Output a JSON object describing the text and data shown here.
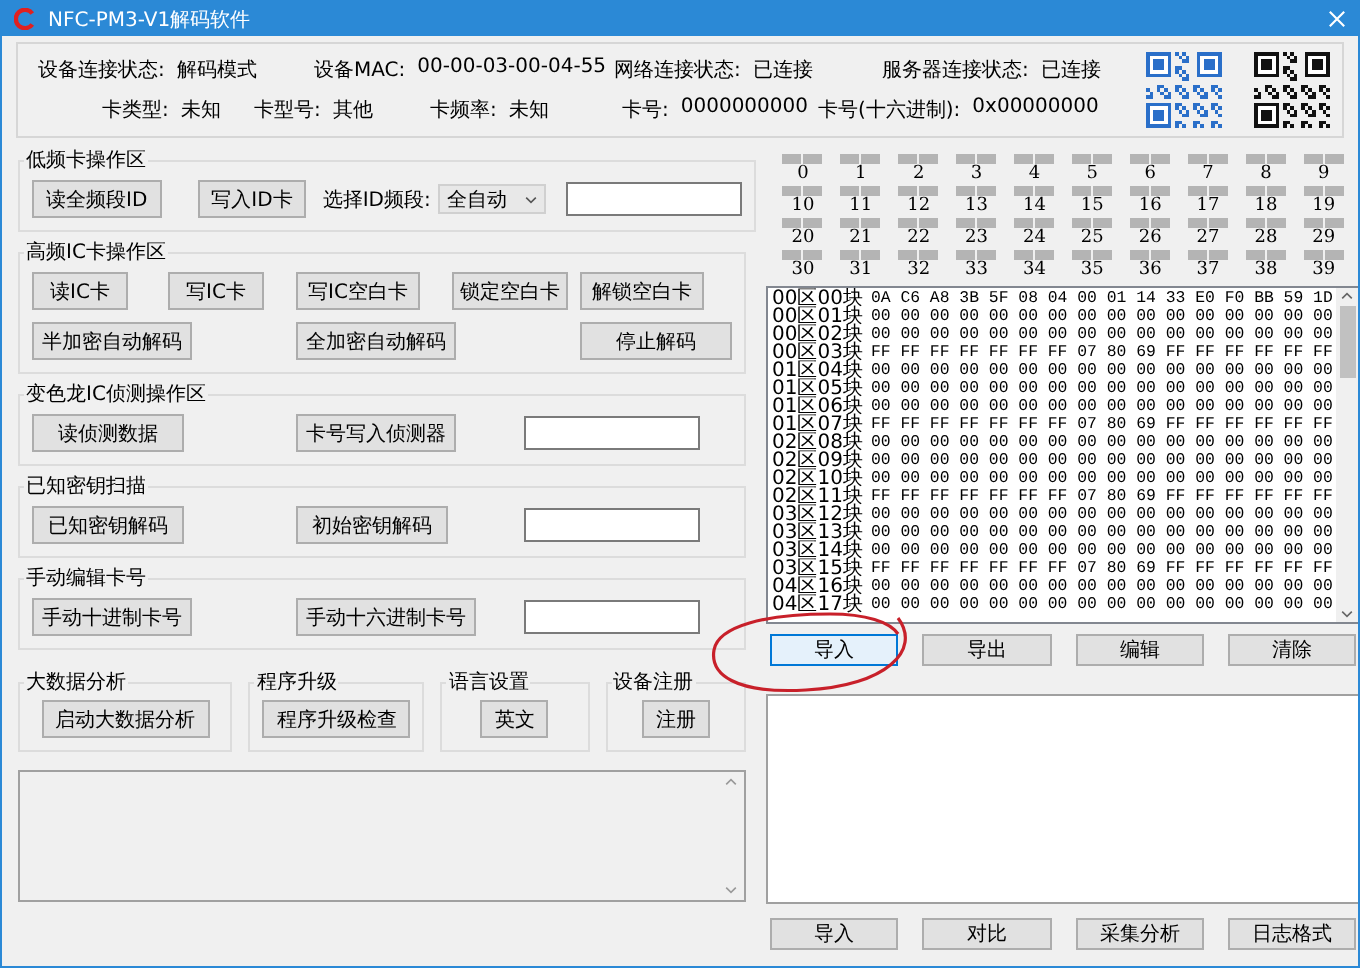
{
  "window": {
    "title": "NFC-PM3-V1解码软件"
  },
  "status_rows": [
    [
      {
        "label": "设备连接状态:",
        "value": "解码模式"
      },
      {
        "label": "设备MAC:",
        "value": "00-00-03-00-04-55"
      },
      {
        "label": "网络连接状态:",
        "value": "已连接"
      },
      {
        "label": "服务器连接状态:",
        "value": "已连接"
      }
    ],
    [
      {
        "label": "卡类型:",
        "value": "未知"
      },
      {
        "label": "卡型号:",
        "value": "其他"
      },
      {
        "label": "卡频率:",
        "value": "未知"
      },
      {
        "label": "卡号:",
        "value": "0000000000"
      },
      {
        "label": "卡号(十六进制):",
        "value": "0x00000000"
      }
    ]
  ],
  "low_freq": {
    "title": "低频卡操作区",
    "buttons": [
      "读全频段ID",
      "写入ID卡"
    ],
    "select_label": "选择ID频段:",
    "select_value": "全自动"
  },
  "high_freq": {
    "title": "高频IC卡操作区",
    "rows": [
      [
        "读IC卡",
        "写IC卡",
        "写IC空白卡",
        "锁定空白卡",
        "解锁空白卡"
      ],
      [
        "半加密自动解码",
        "",
        "全加密自动解码",
        "",
        "停止解码"
      ]
    ]
  },
  "chameleon": {
    "title": "变色龙IC侦测操作区",
    "buttons": [
      "读侦测数据",
      "卡号写入侦测器"
    ]
  },
  "known_keys": {
    "title": "已知密钥扫描",
    "buttons": [
      "已知密钥解码",
      "初始密钥解码"
    ]
  },
  "manual": {
    "title": "手动编辑卡号",
    "buttons": [
      "手动十进制卡号",
      "手动十六进制卡号"
    ]
  },
  "tools": [
    {
      "title": "大数据分析",
      "button": "启动大数据分析"
    },
    {
      "title": "程序升级",
      "button": "程序升级检查"
    },
    {
      "title": "语言设置",
      "button": "英文"
    },
    {
      "title": "设备注册",
      "button": "注册"
    }
  ],
  "sectors": [
    "0",
    "1",
    "2",
    "3",
    "4",
    "5",
    "6",
    "7",
    "8",
    "9",
    "10",
    "11",
    "12",
    "13",
    "14",
    "15",
    "16",
    "17",
    "18",
    "19",
    "20",
    "21",
    "22",
    "23",
    "24",
    "25",
    "26",
    "27",
    "28",
    "29",
    "30",
    "31",
    "32",
    "33",
    "34",
    "35",
    "36",
    "37",
    "38",
    "39"
  ],
  "blocks": [
    {
      "label": "00区00块",
      "bytes": "0A C6 A8 3B 5F 08 04 00 01 14 33 E0 F0 BB 59 1D"
    },
    {
      "label": "00区01块",
      "bytes": "00 00 00 00 00 00 00 00 00 00 00 00 00 00 00 00"
    },
    {
      "label": "00区02块",
      "bytes": "00 00 00 00 00 00 00 00 00 00 00 00 00 00 00 00"
    },
    {
      "label": "00区03块",
      "bytes": "FF FF FF FF FF FF FF 07 80 69 FF FF FF FF FF FF"
    },
    {
      "label": "01区04块",
      "bytes": "00 00 00 00 00 00 00 00 00 00 00 00 00 00 00 00"
    },
    {
      "label": "01区05块",
      "bytes": "00 00 00 00 00 00 00 00 00 00 00 00 00 00 00 00"
    },
    {
      "label": "01区06块",
      "bytes": "00 00 00 00 00 00 00 00 00 00 00 00 00 00 00 00"
    },
    {
      "label": "01区07块",
      "bytes": "FF FF FF FF FF FF FF 07 80 69 FF FF FF FF FF FF"
    },
    {
      "label": "02区08块",
      "bytes": "00 00 00 00 00 00 00 00 00 00 00 00 00 00 00 00"
    },
    {
      "label": "02区09块",
      "bytes": "00 00 00 00 00 00 00 00 00 00 00 00 00 00 00 00"
    },
    {
      "label": "02区10块",
      "bytes": "00 00 00 00 00 00 00 00 00 00 00 00 00 00 00 00"
    },
    {
      "label": "02区11块",
      "bytes": "FF FF FF FF FF FF FF 07 80 69 FF FF FF FF FF FF"
    },
    {
      "label": "03区12块",
      "bytes": "00 00 00 00 00 00 00 00 00 00 00 00 00 00 00 00"
    },
    {
      "label": "03区13块",
      "bytes": "00 00 00 00 00 00 00 00 00 00 00 00 00 00 00 00"
    },
    {
      "label": "03区14块",
      "bytes": "00 00 00 00 00 00 00 00 00 00 00 00 00 00 00 00"
    },
    {
      "label": "03区15块",
      "bytes": "FF FF FF FF FF FF FF 07 80 69 FF FF FF FF FF FF"
    },
    {
      "label": "04区16块",
      "bytes": "00 00 00 00 00 00 00 00 00 00 00 00 00 00 00 00"
    },
    {
      "label": "04区17块",
      "bytes": "00 00 00 00 00 00 00 00 00 00 00 00 00 00 00 00"
    }
  ],
  "block_buttons": [
    {
      "label": "导入",
      "focused": true
    },
    {
      "label": "导出",
      "focused": false
    },
    {
      "label": "编辑",
      "focused": false
    },
    {
      "label": "清除",
      "focused": false
    }
  ],
  "bottom_buttons": [
    "导入",
    "对比",
    "采集分析",
    "日志格式"
  ]
}
